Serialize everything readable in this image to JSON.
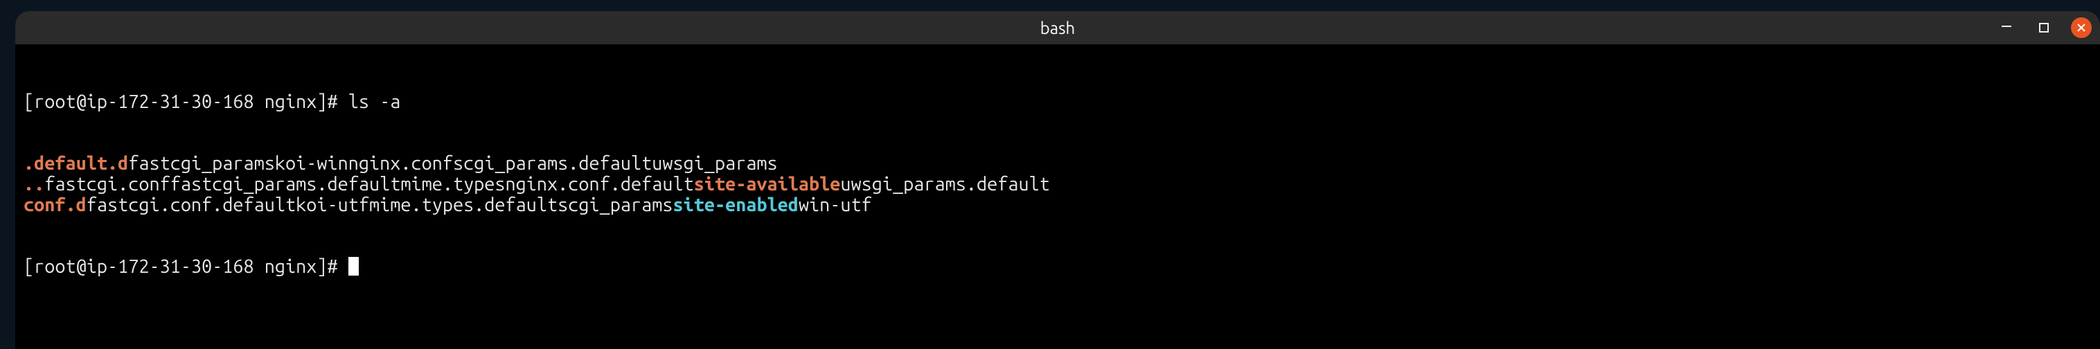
{
  "titlebar": {
    "title": "bash"
  },
  "prompt1": {
    "text": "[root@ip-172-31-30-168 nginx]# ",
    "command": "ls -a"
  },
  "prompt2": {
    "text": "[root@ip-172-31-30-168 nginx]# "
  },
  "listing": {
    "cols_width_ch": [
      8,
      22,
      24,
      20,
      20,
      21,
      20
    ],
    "rows": [
      [
        {
          "name": ".",
          "type": "dir"
        },
        {
          "name": "default.d",
          "type": "dir"
        },
        {
          "name": "fastcgi_params",
          "type": "plain"
        },
        {
          "name": "koi-win",
          "type": "plain"
        },
        {
          "name": "nginx.conf",
          "type": "plain"
        },
        {
          "name": "scgi_params.default",
          "type": "plain"
        },
        {
          "name": "uwsgi_params",
          "type": "plain"
        }
      ],
      [
        {
          "name": "..",
          "type": "dir"
        },
        {
          "name": "fastcgi.conf",
          "type": "plain"
        },
        {
          "name": "fastcgi_params.default",
          "type": "plain"
        },
        {
          "name": "mime.types",
          "type": "plain"
        },
        {
          "name": "nginx.conf.default",
          "type": "plain"
        },
        {
          "name": "site-available",
          "type": "dir"
        },
        {
          "name": "uwsgi_params.default",
          "type": "plain"
        }
      ],
      [
        {
          "name": "conf.d",
          "type": "dir"
        },
        {
          "name": "fastcgi.conf.default",
          "type": "plain"
        },
        {
          "name": "koi-utf",
          "type": "plain"
        },
        {
          "name": "mime.types.default",
          "type": "plain"
        },
        {
          "name": "scgi_params",
          "type": "plain"
        },
        {
          "name": "site-enabled",
          "type": "link"
        },
        {
          "name": "win-utf",
          "type": "plain"
        }
      ]
    ]
  }
}
